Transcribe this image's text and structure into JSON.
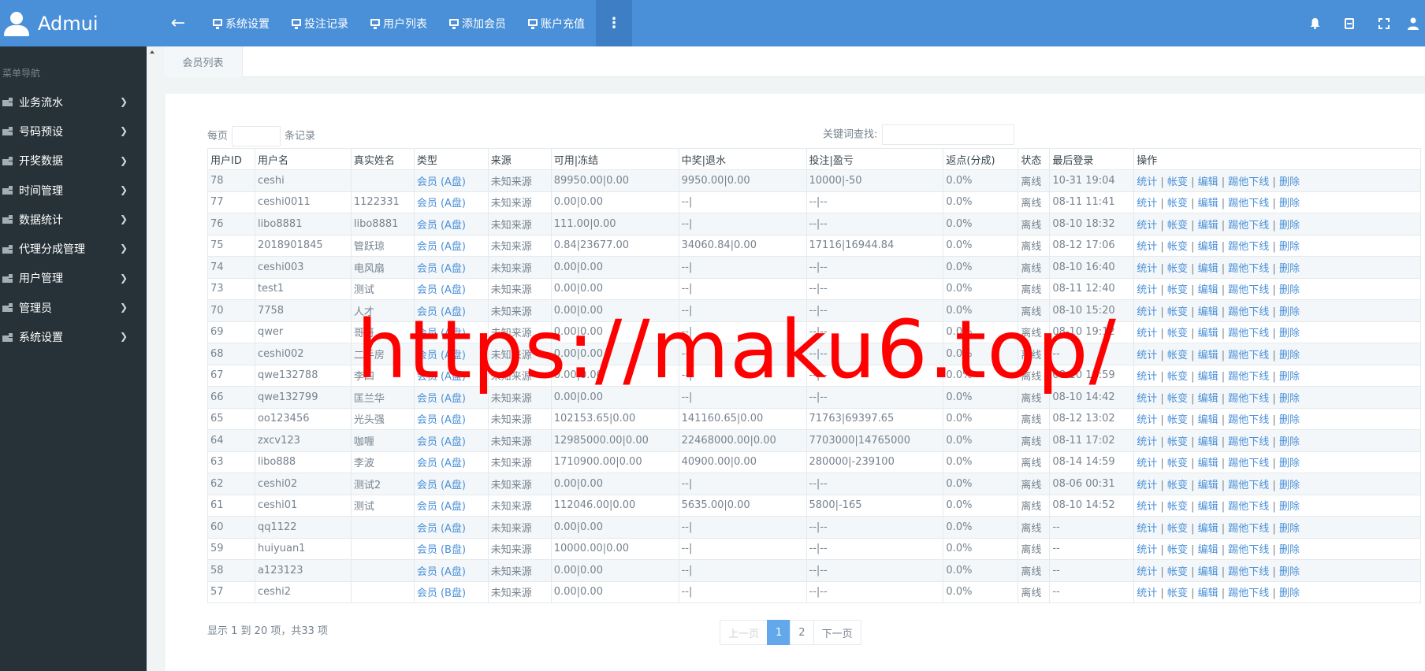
{
  "brand": {
    "name": "Admui"
  },
  "topnav": {
    "items": [
      {
        "label": "系统设置"
      },
      {
        "label": "投注记录"
      },
      {
        "label": "用户列表"
      },
      {
        "label": "添加会员"
      },
      {
        "label": "账户充值"
      }
    ],
    "more": "⋮",
    "back": "←"
  },
  "sidebar": {
    "section": "菜单导航",
    "items": [
      {
        "label": "业务流水"
      },
      {
        "label": "号码预设"
      },
      {
        "label": "开奖数据"
      },
      {
        "label": "时间管理"
      },
      {
        "label": "数据统计"
      },
      {
        "label": "代理分成管理"
      },
      {
        "label": "用户管理"
      },
      {
        "label": "管理员"
      },
      {
        "label": "系统设置"
      }
    ]
  },
  "tab": {
    "label": "会员列表"
  },
  "toolbar": {
    "per_page_prefix": "每页",
    "per_page_suffix": "条记录",
    "search_label": "关键词查找:"
  },
  "table": {
    "headers": [
      "用户ID",
      "用户名",
      "真实姓名",
      "类型",
      "来源",
      "可用|冻结",
      "中奖|退水",
      "投注|盈亏",
      "返点(分成)",
      "状态",
      "最后登录",
      "操作"
    ],
    "rows": [
      [
        "78",
        "ceshi",
        "",
        "会员 (A盘)",
        "未知来源",
        "89950.00|0.00",
        "9950.00|0.00",
        "10000|-50",
        "0.0%",
        "离线",
        "10-31 19:04"
      ],
      [
        "77",
        "ceshi0011",
        "1122331",
        "会员 (A盘)",
        "未知来源",
        "0.00|0.00",
        "--|",
        "--|--",
        "0.0%",
        "离线",
        "08-11 11:41"
      ],
      [
        "76",
        "libo8881",
        "libo8881",
        "会员 (A盘)",
        "未知来源",
        "111.00|0.00",
        "--|",
        "--|--",
        "0.0%",
        "离线",
        "08-10 18:32"
      ],
      [
        "75",
        "2018901845",
        "管跃琼",
        "会员 (A盘)",
        "未知来源",
        "0.84|23677.00",
        "34060.84|0.00",
        "17116|16944.84",
        "0.0%",
        "离线",
        "08-12 17:06"
      ],
      [
        "74",
        "ceshi003",
        "电风扇",
        "会员 (A盘)",
        "未知来源",
        "0.00|0.00",
        "--|",
        "--|--",
        "0.0%",
        "离线",
        "08-10 16:40"
      ],
      [
        "73",
        "test1",
        "测试",
        "会员 (A盘)",
        "未知来源",
        "0.00|0.00",
        "--|",
        "--|--",
        "0.0%",
        "离线",
        "08-11 12:40"
      ],
      [
        "70",
        "7758",
        "人才",
        "会员 (A盘)",
        "未知来源",
        "0.00|0.00",
        "--|",
        "--|--",
        "0.0%",
        "离线",
        "08-10 15:20"
      ],
      [
        "69",
        "qwer",
        "哥哥",
        "会员 (A盘)",
        "未知来源",
        "0.00|0.00",
        "--|",
        "--|--",
        "0.0%",
        "离线",
        "08-10 19:12"
      ],
      [
        "68",
        "ceshi002",
        "二手房",
        "会员 (A盘)",
        "未知来源",
        "0.00|0.00",
        "--|",
        "--|--",
        "0.0%",
        "离线",
        "--"
      ],
      [
        "67",
        "qwe132788",
        "李四",
        "会员 (A盘)",
        "未知来源",
        "0.00|0.00",
        "--|",
        "--|--",
        "0.0%",
        "离线",
        "08-10 14:59"
      ],
      [
        "66",
        "qwe132799",
        "匡兰华",
        "会员 (A盘)",
        "未知来源",
        "0.00|0.00",
        "--|",
        "--|--",
        "0.0%",
        "离线",
        "08-10 14:42"
      ],
      [
        "65",
        "oo123456",
        "光头强",
        "会员 (A盘)",
        "未知来源",
        "102153.65|0.00",
        "141160.65|0.00",
        "71763|69397.65",
        "0.0%",
        "离线",
        "08-12 13:02"
      ],
      [
        "64",
        "zxcv123",
        "咖喱",
        "会员 (A盘)",
        "未知来源",
        "12985000.00|0.00",
        "22468000.00|0.00",
        "7703000|14765000",
        "0.0%",
        "离线",
        "08-11 17:02"
      ],
      [
        "63",
        "libo888",
        "李波",
        "会员 (A盘)",
        "未知来源",
        "1710900.00|0.00",
        "40900.00|0.00",
        "280000|-239100",
        "0.0%",
        "离线",
        "08-14 14:59"
      ],
      [
        "62",
        "ceshi02",
        "测试2",
        "会员 (A盘)",
        "未知来源",
        "0.00|0.00",
        "--|",
        "--|--",
        "0.0%",
        "离线",
        "08-06 00:31"
      ],
      [
        "61",
        "ceshi01",
        "测试",
        "会员 (A盘)",
        "未知来源",
        "112046.00|0.00",
        "5635.00|0.00",
        "5800|-165",
        "0.0%",
        "离线",
        "08-10 14:52"
      ],
      [
        "60",
        "qq1122",
        "",
        "会员 (A盘)",
        "未知来源",
        "0.00|0.00",
        "--|",
        "--|--",
        "0.0%",
        "离线",
        "--"
      ],
      [
        "59",
        "huiyuan1",
        "",
        "会员 (B盘)",
        "未知来源",
        "10000.00|0.00",
        "--|",
        "--|--",
        "0.0%",
        "离线",
        "--"
      ],
      [
        "58",
        "a123123",
        "",
        "会员 (A盘)",
        "未知来源",
        "0.00|0.00",
        "--|",
        "--|--",
        "0.0%",
        "离线",
        "--"
      ],
      [
        "57",
        "ceshi2",
        "",
        "会员 (B盘)",
        "未知来源",
        "0.00|0.00",
        "--|",
        "--|--",
        "0.0%",
        "离线",
        "--"
      ]
    ],
    "ops": [
      "统计",
      "帐变",
      "编辑",
      "踢他下线",
      "删除"
    ]
  },
  "pagination": {
    "info": "显示 1 到 20 项，共33 项",
    "prev": "上一页",
    "pages": [
      "1",
      "2"
    ],
    "next": "下一页",
    "current": "1"
  },
  "watermark": "https://maku6.top/",
  "colors": {
    "topbar": "#4a90d9",
    "sidebar": "#263238",
    "link": "#4a90d9",
    "active_page": "#62a8ea",
    "watermark": "#ff0000"
  }
}
